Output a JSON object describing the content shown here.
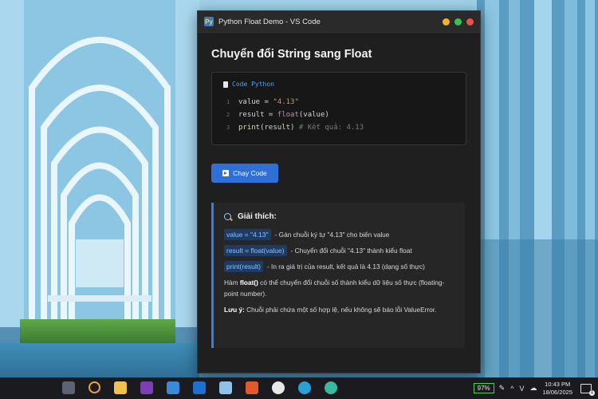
{
  "window": {
    "title": "Python Float Demo - VS Code",
    "app_icon_glyph": "Py"
  },
  "main": {
    "heading": "Chuyển đổi String sang Float",
    "code": {
      "label": "Code Python",
      "lines": [
        {
          "num": "1",
          "var": "value",
          "op": " = ",
          "str": "\"4.13\""
        },
        {
          "num": "2",
          "var": "result",
          "op": " = ",
          "fn": "float",
          "arg": "(value)"
        },
        {
          "num": "3",
          "fn": "print",
          "arg": "(result)",
          "comment": " # Kết quả: 4.13"
        }
      ]
    },
    "run_button": "Chạy Code",
    "explain": {
      "title": "Giải thích:",
      "rows": [
        {
          "chip": "value = \"4.13\"",
          "text": "- Gán chuỗi ký tự \"4.13\" cho biến value"
        },
        {
          "chip": "result = float(value)",
          "text": "- Chuyển đổi chuỗi \"4.13\" thành kiểu float"
        },
        {
          "chip": "print(result)",
          "text": "- In ra giá trị của result, kết quả là 4.13 (dạng số thực)"
        }
      ],
      "para_prefix": "Hàm ",
      "para_bold": "float()",
      "para_rest": " có thể chuyển đổi chuỗi số thành kiểu dữ liệu số thực (floating-point number).",
      "note_bold": "Lưu ý:",
      "note_rest": " Chuỗi phải chứa một số hợp lệ, nếu không sẽ báo lỗi ValueError."
    }
  },
  "taskbar": {
    "icons": [
      "calculator-icon",
      "search-icon",
      "file-explorer-icon",
      "onenote-icon",
      "photos-icon",
      "outlook-icon",
      "notepad-icon",
      "slides-icon",
      "chrome-icon",
      "edge-icon",
      "edge-beta-icon"
    ],
    "battery": "97%",
    "time": "10:43 PM",
    "date": "18/06/2025",
    "notification_count": "1",
    "tray_glyphs": {
      "chevron": "^",
      "lang": "V",
      "pen": "⌒",
      "cloud": "☁"
    }
  },
  "colors": {
    "accent": "#2f6fd6",
    "window_bg": "#1f1f1f",
    "code_string": "#ce9178",
    "code_function": "#dcdcaa",
    "battery_border": "#4fce4f"
  }
}
